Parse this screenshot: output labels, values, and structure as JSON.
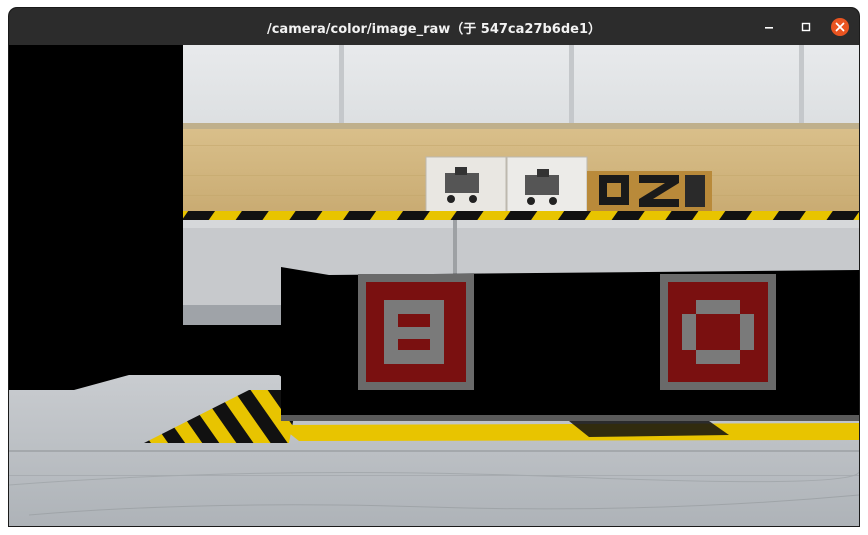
{
  "window": {
    "title": "/camera/color/image_raw（于 547ca27b6de1）",
    "controls": {
      "minimize_icon": "minimize-icon",
      "maximize_icon": "maximize-icon",
      "close_icon": "close-icon",
      "close_color": "#e95420"
    }
  },
  "image": {
    "markers": [
      {
        "letter": "B",
        "border_color": "#6a6a6a",
        "fill_color": "#7a1010"
      },
      {
        "letter": "O",
        "border_color": "#6a6a6a",
        "fill_color": "#7a1010"
      }
    ],
    "hazard_colors": {
      "yellow": "#e8c400",
      "black": "#111111"
    }
  }
}
